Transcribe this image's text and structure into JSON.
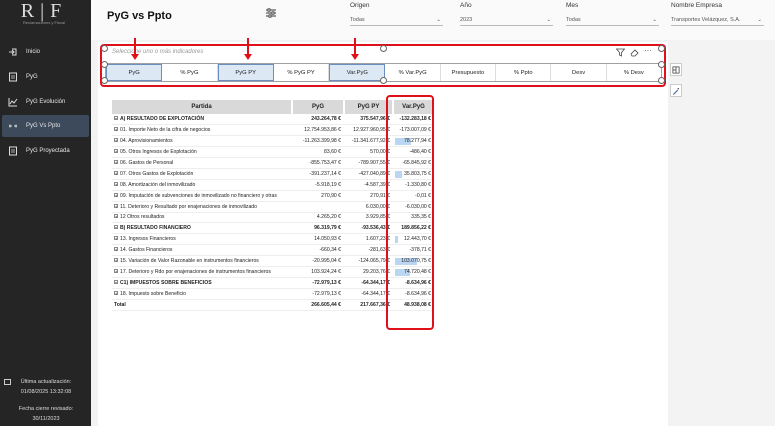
{
  "sidebar": {
    "logo": "R|F",
    "logo_tag": "Reclamaciones y Fiscal",
    "items": [
      {
        "label": "Inicio",
        "icon": "login-icon"
      },
      {
        "label": "PyG",
        "icon": "report-icon"
      },
      {
        "label": "PyG Evolución",
        "icon": "line-chart-icon"
      },
      {
        "label": "PyG Vs Ppto",
        "icon": "compare-icon"
      },
      {
        "label": "PyG Proyectada",
        "icon": "report-icon"
      }
    ],
    "last_update_label": "Última actualización:",
    "last_update_value": "01/08/2025 13:32:08",
    "close_label": "Fecha cierre revisado:",
    "close_value": "30/11/2023"
  },
  "header": {
    "title": "PyG vs Ppto",
    "slicers": [
      {
        "label": "Origen",
        "value": "Todas"
      },
      {
        "label": "Año",
        "value": "2023"
      },
      {
        "label": "Mes",
        "value": "Todas"
      },
      {
        "label": "Nombre Empresa",
        "value": "Transportes Velázquez, S.A."
      }
    ]
  },
  "selector": {
    "placeholder": "Seleccione uno o más indicadores",
    "chips": [
      {
        "label": "PyG",
        "selected": true
      },
      {
        "label": "% PyG",
        "selected": false
      },
      {
        "label": "PyG PY",
        "selected": true
      },
      {
        "label": "% PyG PY",
        "selected": false
      },
      {
        "label": "Var.PyG",
        "selected": true
      },
      {
        "label": "% Var.PyG",
        "selected": false
      },
      {
        "label": "Presupuesto",
        "selected": false
      },
      {
        "label": "% Ppto",
        "selected": false
      },
      {
        "label": "Desv",
        "selected": false
      },
      {
        "label": "% Desv",
        "selected": false
      }
    ]
  },
  "table": {
    "columns": [
      "Partida",
      "PyG",
      "PyG PY",
      "Var.PyG"
    ],
    "rows": [
      {
        "name": "A) RESULTADO DE EXPLOTACIÓN",
        "pyg": "243.264,78 €",
        "py": "375.547,96 €",
        "var": "-132.283,18 €",
        "type": "hdr",
        "bar": 0
      },
      {
        "name": "01. Importe Neto de la cifra de negocios",
        "pyg": "12.754.953,86 €",
        "py": "12.927.960,95 €",
        "var": "-173.007,09 €",
        "type": "sub",
        "bar": 0
      },
      {
        "name": "04. Aprovisionamientos",
        "pyg": "-11.263.399,98 €",
        "py": "-11.341.677,92 €",
        "var": "78.277,94 €",
        "type": "sub",
        "bar": 0.45
      },
      {
        "name": "05. Otros Ingresos de Explotación",
        "pyg": "83,60 €",
        "py": "570,00 €",
        "var": "-486,40 €",
        "type": "sub",
        "bar": 0
      },
      {
        "name": "06. Gastos de Personal",
        "pyg": "-855.753,47 €",
        "py": "-789.907,55 €",
        "var": "-65.845,92 €",
        "type": "sub",
        "bar": 0
      },
      {
        "name": "07. Otros Gastos de Explotación",
        "pyg": "-391.237,14 €",
        "py": "-427.040,89 €",
        "var": "35.803,75 €",
        "type": "sub",
        "bar": 0.2
      },
      {
        "name": "08. Amortización del inmovilizado",
        "pyg": "-5.918,19 €",
        "py": "-4.587,39 €",
        "var": "-1.330,80 €",
        "type": "sub",
        "bar": 0
      },
      {
        "name": "09. Imputación de subvenciones de inmovilizado no financiero y otras",
        "pyg": "270,90 €",
        "py": "270,91 €",
        "var": "-0,01 €",
        "type": "sub",
        "bar": 0
      },
      {
        "name": "11. Deterioro y Resultado por enajenaciones de inmovilizado",
        "pyg": "",
        "py": "6.030,00 €",
        "var": "-6.030,00 €",
        "type": "sub",
        "bar": 0
      },
      {
        "name": "12 Otros resultados",
        "pyg": "4.265,20 €",
        "py": "3.929,85 €",
        "var": "335,35 €",
        "type": "sub",
        "bar": 0
      },
      {
        "name": "B) RESULTADO FINANCIERO",
        "pyg": "96.319,79 €",
        "py": "-93.536,43 €",
        "var": "189.856,22 €",
        "type": "hdr",
        "bar": 0
      },
      {
        "name": "13. Ingresos Financieros",
        "pyg": "14.050,93 €",
        "py": "1.607,23 €",
        "var": "12.443,70 €",
        "type": "sub",
        "bar": 0.08
      },
      {
        "name": "14. Gastos Financieros",
        "pyg": "-660,34 €",
        "py": "-281,63 €",
        "var": "-378,71 €",
        "type": "sub",
        "bar": 0
      },
      {
        "name": "15. Variación de Valor Razonable en instrumentos financieros",
        "pyg": "-20.995,04 €",
        "py": "-124.065,79 €",
        "var": "103.070,75 €",
        "type": "sub",
        "bar": 0.6
      },
      {
        "name": "17. Deterioro y Rdo por enajenaciones de instrumentos financieros",
        "pyg": "103.924,24 €",
        "py": "29.203,76 €",
        "var": "74.720,48 €",
        "type": "sub",
        "bar": 0.43
      },
      {
        "name": "C1) IMPUESTOS SOBRE BENEFICIOS",
        "pyg": "-72.979,13 €",
        "py": "-64.344,17 €",
        "var": "-8.634,96 €",
        "type": "hdr",
        "bar": 0
      },
      {
        "name": "18. Impuesto sobre Beneficio",
        "pyg": "-72.979,13 €",
        "py": "-64.344,17 €",
        "var": "-8.634,96 €",
        "type": "sub",
        "bar": 0
      },
      {
        "name": "Total",
        "pyg": "266.605,44 €",
        "py": "217.667,36 €",
        "var": "48.938,08 €",
        "type": "tot",
        "bar": 0
      }
    ]
  }
}
